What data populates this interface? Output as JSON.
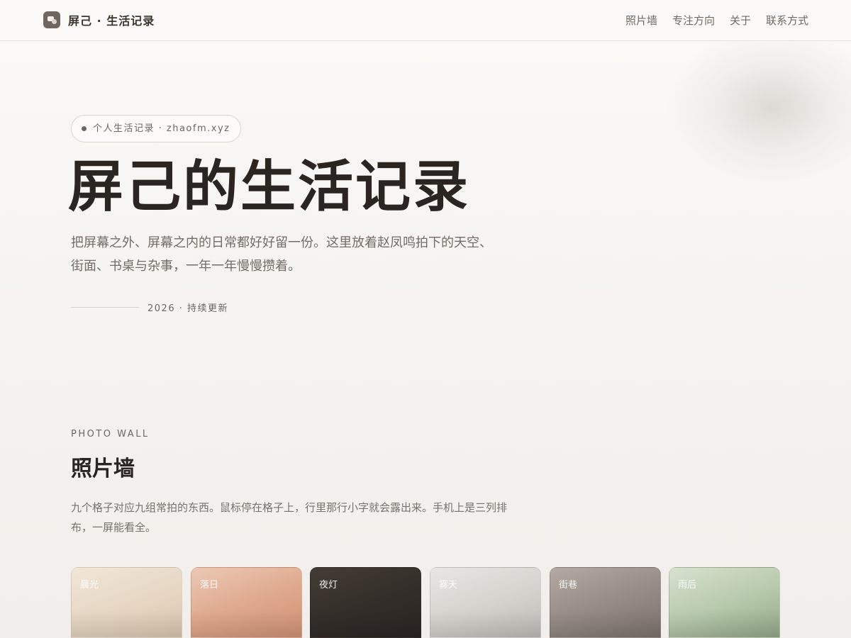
{
  "brand": {
    "name": "屏己 · 生活记录",
    "logo_icon": "photo-stack-icon"
  },
  "nav": {
    "items": [
      {
        "label": "照片墙"
      },
      {
        "label": "专注方向"
      },
      {
        "label": "关于"
      },
      {
        "label": "联系方式"
      }
    ]
  },
  "hero": {
    "tag": "个人生活记录 · zhaofm.xyz",
    "title": "屏己的生活记录",
    "description": "把屏幕之外、屏幕之内的日常都好好留一份。这里放着赵凤鸣拍下的天空、街面、书桌与杂事，一年一年慢慢攒着。",
    "meta": "2026 · 持续更新"
  },
  "photo_wall": {
    "eyebrow": "PHOTO WALL",
    "title": "照片墙",
    "description": "九个格子对应九组常拍的东西。鼠标停在格子上，行里那行小字就会露出来。手机上是三列排布，一屏能看全。",
    "cards": [
      {
        "label": "晨光",
        "color": "#e6d6c3"
      },
      {
        "label": "落日",
        "color": "#dea78b"
      },
      {
        "label": "夜灯",
        "color": "#332d29"
      },
      {
        "label": "雾天",
        "color": "#d5d1cd"
      },
      {
        "label": "街巷",
        "color": "#958a83"
      },
      {
        "label": "雨后",
        "color": "#b6c8aa"
      }
    ]
  },
  "colors": {
    "background": "#f5f2ef",
    "text_primary": "#2a2521",
    "text_secondary": "#746c66"
  }
}
